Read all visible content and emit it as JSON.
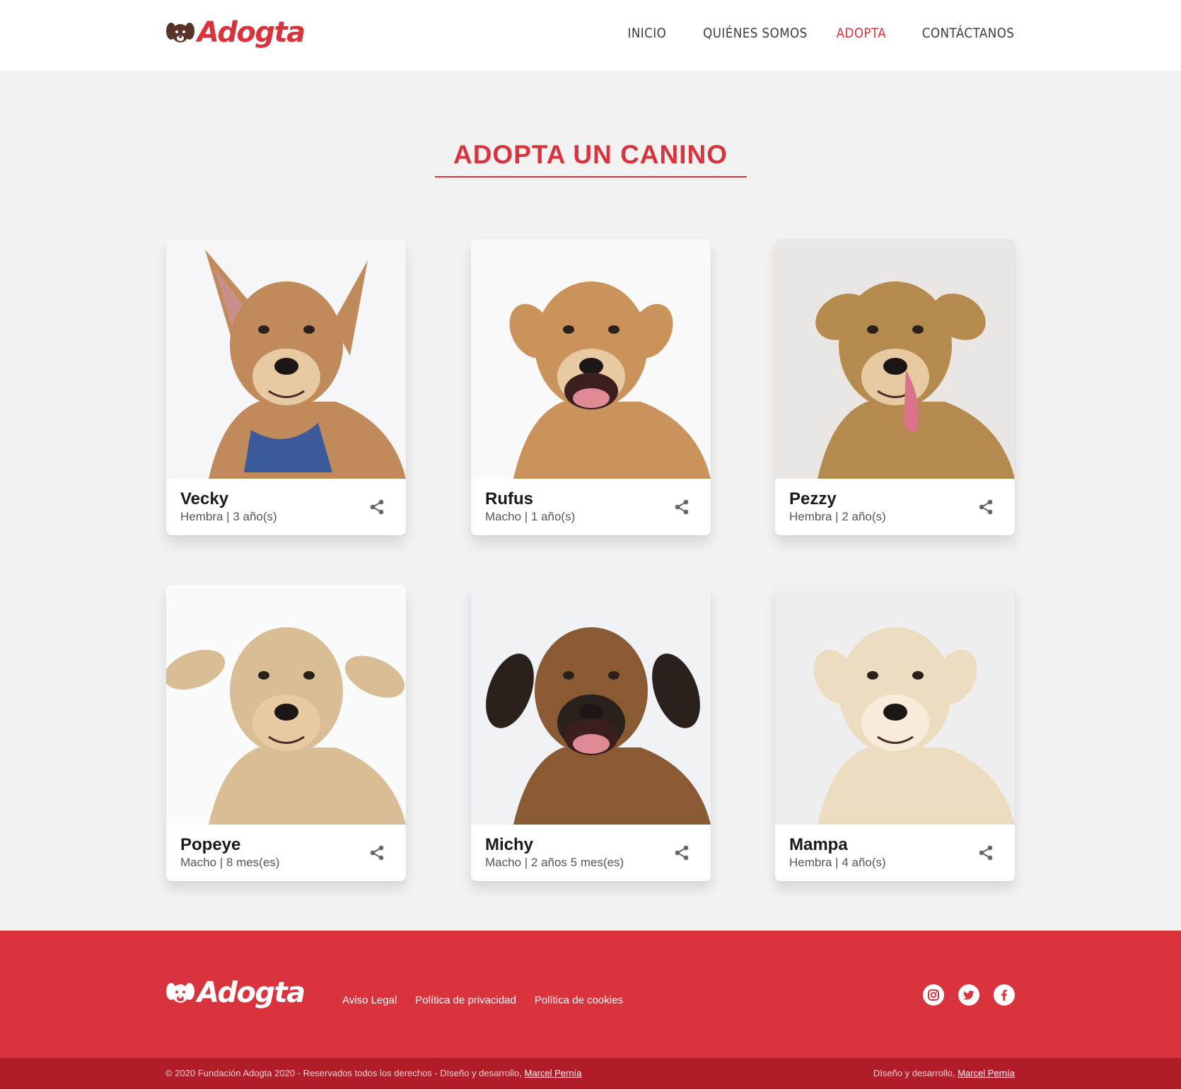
{
  "brand": {
    "name": "Adogta",
    "accent": "#d9333e",
    "footer_bg": "#d9333e",
    "bottom_bg": "#b01d28"
  },
  "nav": {
    "items": [
      {
        "label": "INICIO",
        "active": false
      },
      {
        "label": "QUIÉNES SOMOS",
        "active": false
      },
      {
        "label": "ADOPTA",
        "active": true
      },
      {
        "label": "CONTÁCTANOS",
        "active": false
      }
    ]
  },
  "page": {
    "title": "ADOPTA UN CANINO"
  },
  "dogs": [
    {
      "name": "Vecky",
      "info": "Hembra | 3 año(s)",
      "photo": "dog-photo-big-ears",
      "coat": "#c08a5a"
    },
    {
      "name": "Rufus",
      "info": "Macho | 1 año(s)",
      "photo": "dog-photo-open-mouth",
      "coat": "#c9935b"
    },
    {
      "name": "Pezzy",
      "info": "Hembra | 2 año(s)",
      "photo": "dog-photo-tongue-out",
      "coat": "#b58a4e"
    },
    {
      "name": "Popeye",
      "info": "Macho | 8 mes(es)",
      "photo": "dog-photo-floppy-ears",
      "coat": "#d8bd95"
    },
    {
      "name": "Michy",
      "info": "Macho | 2 años 5 mes(es)",
      "photo": "dog-photo-dark-muzzle",
      "coat": "#8a5a32"
    },
    {
      "name": "Mampa",
      "info": "Hembra | 4 año(s)",
      "photo": "dog-photo-cream",
      "coat": "#ecdcc0"
    }
  ],
  "footer": {
    "links": [
      "Aviso Legal",
      "Política de privacidad",
      "Política de cookies"
    ],
    "social": [
      "instagram-icon",
      "twitter-icon",
      "facebook-icon"
    ],
    "copyright": "© 2020 Fundación Adogta 2020 - Reservados todos los derechos - DIseño y desarrollo,",
    "copyright_link": "Marcel Pernía",
    "credit": "DIseño y desarrollo,",
    "credit_link": "Marcel Pernía"
  }
}
